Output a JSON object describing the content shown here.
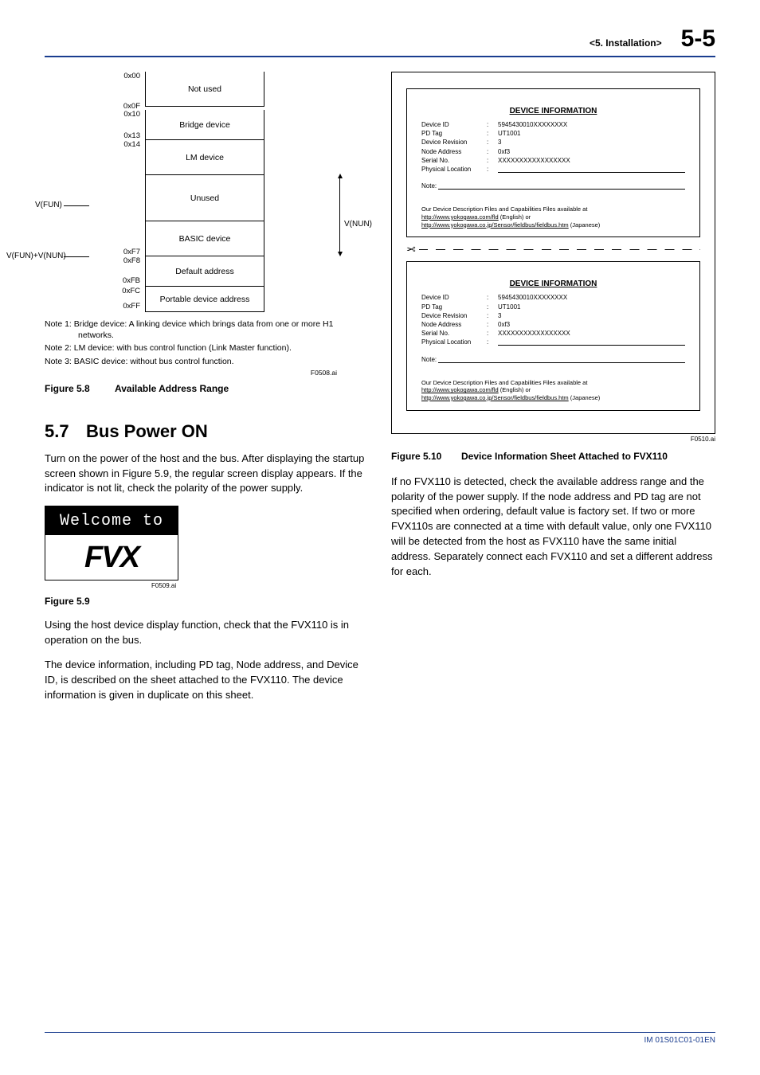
{
  "header": {
    "chapter": "<5.  Installation>",
    "page": "5-5"
  },
  "addr": {
    "ticks": {
      "t0": "0x00",
      "t1a": "0x0F",
      "t1b": "0x10",
      "t2a": "0x13",
      "t2b": "0x14",
      "t5a": "0xF7",
      "t5b": "0xF8",
      "t6a": "0xFB",
      "t6b": "0xFC",
      "t7": "0xFF"
    },
    "rows": {
      "r0": "Not used",
      "r1": "Bridge device",
      "r2": "LM device",
      "r3": "Unused",
      "r4": "BASIC device",
      "r5": "Default address",
      "r6": "Portable device address"
    },
    "labels": {
      "vfun": "V(FUN)",
      "vfunnun": "V(FUN)+V(NUN)",
      "vnun": "V(NUN)"
    }
  },
  "notes": {
    "n1": "Note 1: Bridge device: A linking device which brings data from one or more H1 networks.",
    "n2": "Note 2: LM device: with bus control function (Link Master function).",
    "n3": "Note 3: BASIC device: without bus control function.",
    "ref": "F0508.ai"
  },
  "fig58": {
    "num": "Figure 5.8",
    "title": "Available Address Range"
  },
  "sec57": {
    "num": "5.7",
    "title": "Bus Power ON"
  },
  "p1": "Turn on the power of the host and the bus. After displaying the startup screen shown in Figure 5.9, the regular screen display appears. If the indicator is not lit, check the polarity of the power supply.",
  "lcd": {
    "line1": "Welcome to",
    "line2": "FVX",
    "ref": "F0509.ai"
  },
  "fig59": "Figure 5.9",
  "p2": "Using the host device display function, check that the FVX110 is in operation on the bus.",
  "p3": "The device information, including PD tag, Node address, and Device ID, is described on the sheet attached to the FVX110. The device information is given in duplicate on this sheet.",
  "sheet": {
    "title": "DEVICE INFORMATION",
    "rows": [
      {
        "k": "Device ID",
        "v": "5945430010XXXXXXXX"
      },
      {
        "k": "PD Tag",
        "v": "UT1001"
      },
      {
        "k": "Device Revision",
        "v": "3"
      },
      {
        "k": "Node Address",
        "v": "0xf3"
      },
      {
        "k": "Serial No.",
        "v": "XXXXXXXXXXXXXXXXX"
      },
      {
        "k": "Physical Location",
        "v": ""
      }
    ],
    "noteLabel": "Note:",
    "foot1": "Our Device Description Files and Capabilities Files available at",
    "foot2a": "http://www.yokogawa.com/fld",
    "foot2b": " (English)   or",
    "foot3a": "http://www.yokogawa.co.jp/Sensor/fieldbus/fieldbus.htm",
    "foot3b": " (Japanese)",
    "ref": "F0510.ai"
  },
  "fig510": {
    "num": "Figure 5.10",
    "title": "Device Information Sheet Attached to FVX110"
  },
  "p4": "If no FVX110 is detected, check the available address range and the polarity of the power supply. If the node address and PD tag are not specified when ordering, default value is factory set. If two or more FVX110s are connected at a time with default value, only one FVX110 will be detected from the host as FVX110 have the same initial address. Separately connect each FVX110 and set a different address for each.",
  "footer": "IM 01S01C01-01EN"
}
